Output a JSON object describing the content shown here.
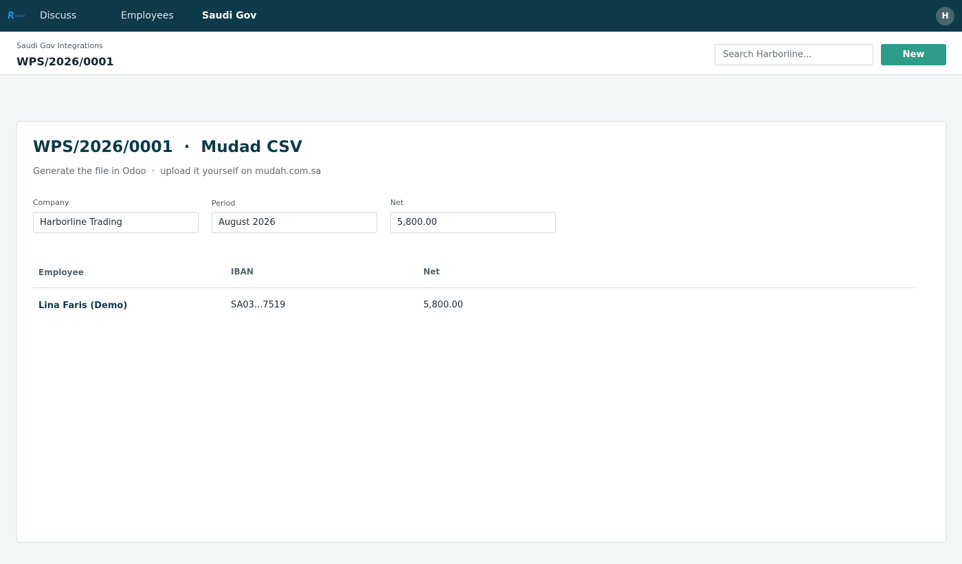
{
  "nav": {
    "logo_icon": "brand-logo-icon",
    "items": [
      {
        "label": "Discuss",
        "active": false
      },
      {
        "label": "Employees",
        "active": false
      },
      {
        "label": "Saudi Gov",
        "active": true
      }
    ],
    "avatar_initial": "H"
  },
  "control_panel": {
    "breadcrumb": "Saudi Gov Integrations",
    "title": "WPS/2026/0001",
    "search_placeholder": "Search Harborline...",
    "new_button_label": "New"
  },
  "sheet": {
    "title": "WPS/2026/0001  ·  Mudad CSV",
    "subtitle": "Generate the file in Odoo  ·  upload it yourself on mudah.com.sa",
    "fields": [
      {
        "label": "Company",
        "value": "Harborline Trading"
      },
      {
        "label": "Period",
        "value": "August 2026"
      },
      {
        "label": "Net",
        "value": "5,800.00"
      }
    ],
    "table": {
      "headers": [
        "Employee",
        "IBAN",
        "Net"
      ],
      "rows": [
        [
          "Lina Faris (Demo)",
          "SA03...7519",
          "5,800.00"
        ]
      ]
    }
  },
  "colors": {
    "navbar": "#0e3a4a",
    "accent": "#2d9c8a",
    "background": "#f2f6f6"
  }
}
